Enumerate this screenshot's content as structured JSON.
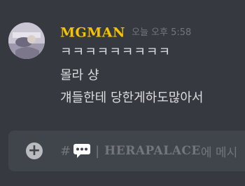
{
  "message": {
    "username": "MGMAN",
    "timestamp": "오늘 오후 5:58",
    "avatar_icon": "avatar",
    "lines": [
      "ㅋㅋㅋㅋㅋㅋㅋㅋㅋ",
      "몰라 샹",
      "걔들한테 당한게하도많아서"
    ]
  },
  "composer": {
    "plus_icon": "plus-circle-icon",
    "hash": "#",
    "channel_icon": "speech-bubble-icon",
    "separator": "|",
    "channel_name": "HERAPALACE",
    "placeholder_suffix": "에 메시"
  },
  "colors": {
    "background": "#36393f",
    "username": "#f5c400",
    "text": "#dcddde",
    "muted": "#72767d",
    "composer_bg": "#40444b"
  }
}
